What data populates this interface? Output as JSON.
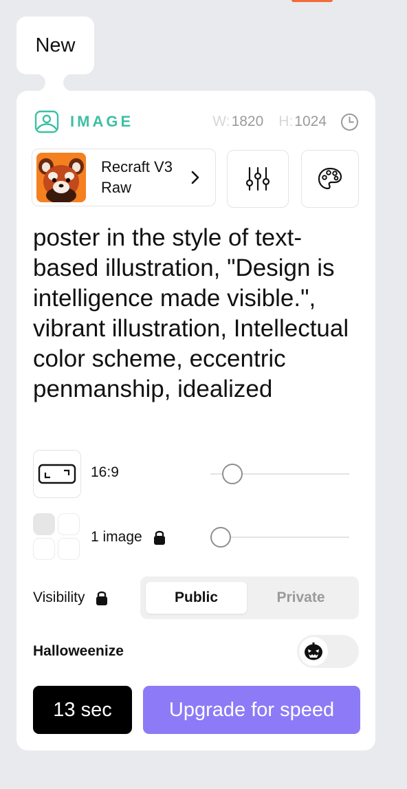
{
  "tab": {
    "label": "New"
  },
  "header": {
    "type_label": "IMAGE",
    "width_key": "W:",
    "width_value": "1820",
    "height_key": "H:",
    "height_value": "1024"
  },
  "model": {
    "name": "Recraft V3 Raw"
  },
  "icons": {
    "image": "image-icon",
    "clock": "clock-icon",
    "chevron": "chevron-right-icon",
    "sliders": "sliders-icon",
    "palette": "palette-icon",
    "aspect": "aspect-ratio-icon",
    "lock": "lock-icon",
    "halloween": "jack-o-lantern-icon"
  },
  "prompt": "poster in the style of text-based illustration, \"Design is intelligence made visible.\", vibrant illustration, Intellectual color scheme, eccentric penmanship, idealized",
  "aspect": {
    "label": "16:9",
    "slider_value": 0.1
  },
  "count": {
    "label": "1 image",
    "slider_value": 0.0
  },
  "visibility": {
    "label": "Visibility",
    "options": [
      "Public",
      "Private"
    ],
    "selected": "Public"
  },
  "halloweenize": {
    "label": "Halloweenize",
    "enabled": false
  },
  "actions": {
    "timer_label": "13 sec",
    "upgrade_label": "Upgrade for speed"
  },
  "colors": {
    "accent_teal": "#3dbfa5",
    "upgrade_purple": "#8d7af7",
    "top_accent": "#f26b3a"
  }
}
